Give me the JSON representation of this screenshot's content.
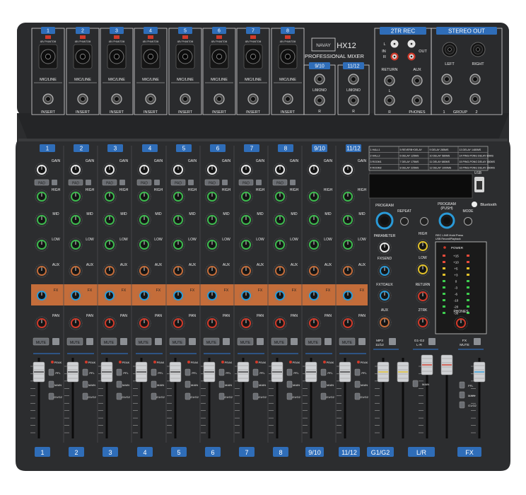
{
  "brand": {
    "logo": "NAVAY",
    "model": "HX12",
    "subtitle": "PROFESSIONAL MIXER"
  },
  "mic_channels": [
    {
      "number": "1",
      "phantom_label": "48V PHANTOM",
      "input_label": "MIC/LINE",
      "insert_label": "INSERT"
    },
    {
      "number": "2",
      "phantom_label": "48V PHANTOM",
      "input_label": "MIC/LINE",
      "insert_label": "INSERT"
    },
    {
      "number": "3",
      "phantom_label": "48V PHANTOM",
      "input_label": "MIC/LINE",
      "insert_label": "INSERT"
    },
    {
      "number": "4",
      "phantom_label": "48V PHANTOM",
      "input_label": "MIC/LINE",
      "insert_label": "INSERT"
    },
    {
      "number": "5",
      "phantom_label": "48V PHANTOM",
      "input_label": "MIC/LINE",
      "insert_label": "INSERT"
    },
    {
      "number": "6",
      "phantom_label": "48V PHANTOM",
      "input_label": "MIC/LINE",
      "insert_label": "INSERT"
    },
    {
      "number": "7",
      "phantom_label": "48V PHANTOM",
      "input_label": "MIC/LINE",
      "insert_label": "INSERT"
    },
    {
      "number": "8",
      "phantom_label": "48V PHANTOM",
      "input_label": "MIC/LINE",
      "insert_label": "INSERT"
    }
  ],
  "stereo_inputs": [
    {
      "number": "9/10",
      "jack_label_top": "L/MONO",
      "jack_label_bottom": "R"
    },
    {
      "number": "11/12",
      "jack_label_top": "L/MONO",
      "jack_label_bottom": "R"
    }
  ],
  "two_track": {
    "title": "2TR REC",
    "in_label": "IN",
    "out_label": "OUT",
    "l": "L",
    "r": "R",
    "return_label": "RETURN",
    "return_l": "L",
    "return_r": "R"
  },
  "stereo_out": {
    "title": "STEREO OUT",
    "left": "LEFT",
    "right": "RIGHT",
    "aux": "AUX",
    "phones": "PHONES",
    "group": "GROUP",
    "group_1": "1",
    "group_2": "2"
  },
  "strip_labels": {
    "gain": "GAIN",
    "pad": "PAD",
    "high": "HIGH",
    "mid": "MID",
    "low": "LOW",
    "aux": "AUX",
    "fx": "FX",
    "pan": "PAN",
    "mute": "MUTE",
    "peak": "PEAK",
    "pfl": "PFL",
    "main": "MAIN",
    "g12": "G1/G2"
  },
  "strip_numbers": [
    "1",
    "2",
    "3",
    "4",
    "5",
    "6",
    "7",
    "8",
    "9/10",
    "11/12"
  ],
  "fx_programs": [
    "1 HALL1",
    "5 REVERB+DELAY",
    "9 DELAY 285MS",
    "13 DELAY 1480MS",
    "2 HALL2",
    "6 DELAY 125MS",
    "10 DELAY 580MS",
    "14 PING-PONG DELAY 80MS",
    "3 ROOM1",
    "7 DELAY 175MS",
    "11 DELAY 680MS",
    "15 PING-PONG DELAY 160MS",
    "4 ROOM2",
    "8 DELAY 225MS",
    "12 DELAY 1000MS",
    "16 PING-PONG DELAY 260MS"
  ],
  "usb": "USB",
  "bluetooth": "Bluetooth",
  "fx_controls": {
    "program": "PROGRAM",
    "parameter": "PARAMETER",
    "fx_send": "FXSEND",
    "fx_to_aux": "FXTOAUX",
    "aux": "AUX"
  },
  "player": {
    "repeat": "REPEAT",
    "program_push": "PROGRAM\n(PUSH)",
    "mode": "MODE",
    "rec_line": "REC LINE:Hold Press",
    "rec_line2": "USB Record/Playback"
  },
  "master_knobs": {
    "high": "HIGH",
    "low": "LOW",
    "return": "RETURN",
    "two_trk": "2TRK",
    "phones": "PHONES"
  },
  "meter": {
    "power": "POWER",
    "labels": [
      "+15",
      "+10",
      "+5",
      "+3",
      "0",
      "-3",
      "-6",
      "-10",
      "-20",
      "-30"
    ]
  },
  "master_buttons": {
    "mp3": "MP3",
    "mp3_sub": "11/12",
    "g12": "G1-G2",
    "g12_sub": "L-R",
    "fx_mute": "FX",
    "fx_mute_sub": "MUTE"
  },
  "bottom_labels": [
    "1",
    "2",
    "3",
    "4",
    "5",
    "6",
    "7",
    "8",
    "9/10",
    "11/12",
    "G1/G2",
    "L/R",
    "FX"
  ],
  "colors": {
    "panel": "#2b2c2e",
    "label_blue": "#2f6db8",
    "fx_orange": "#c46d3a",
    "knob_green": "#3dbb4e",
    "knob_yellow": "#e0c02a",
    "knob_red": "#d23a2a",
    "knob_blue": "#2a9ad8"
  }
}
